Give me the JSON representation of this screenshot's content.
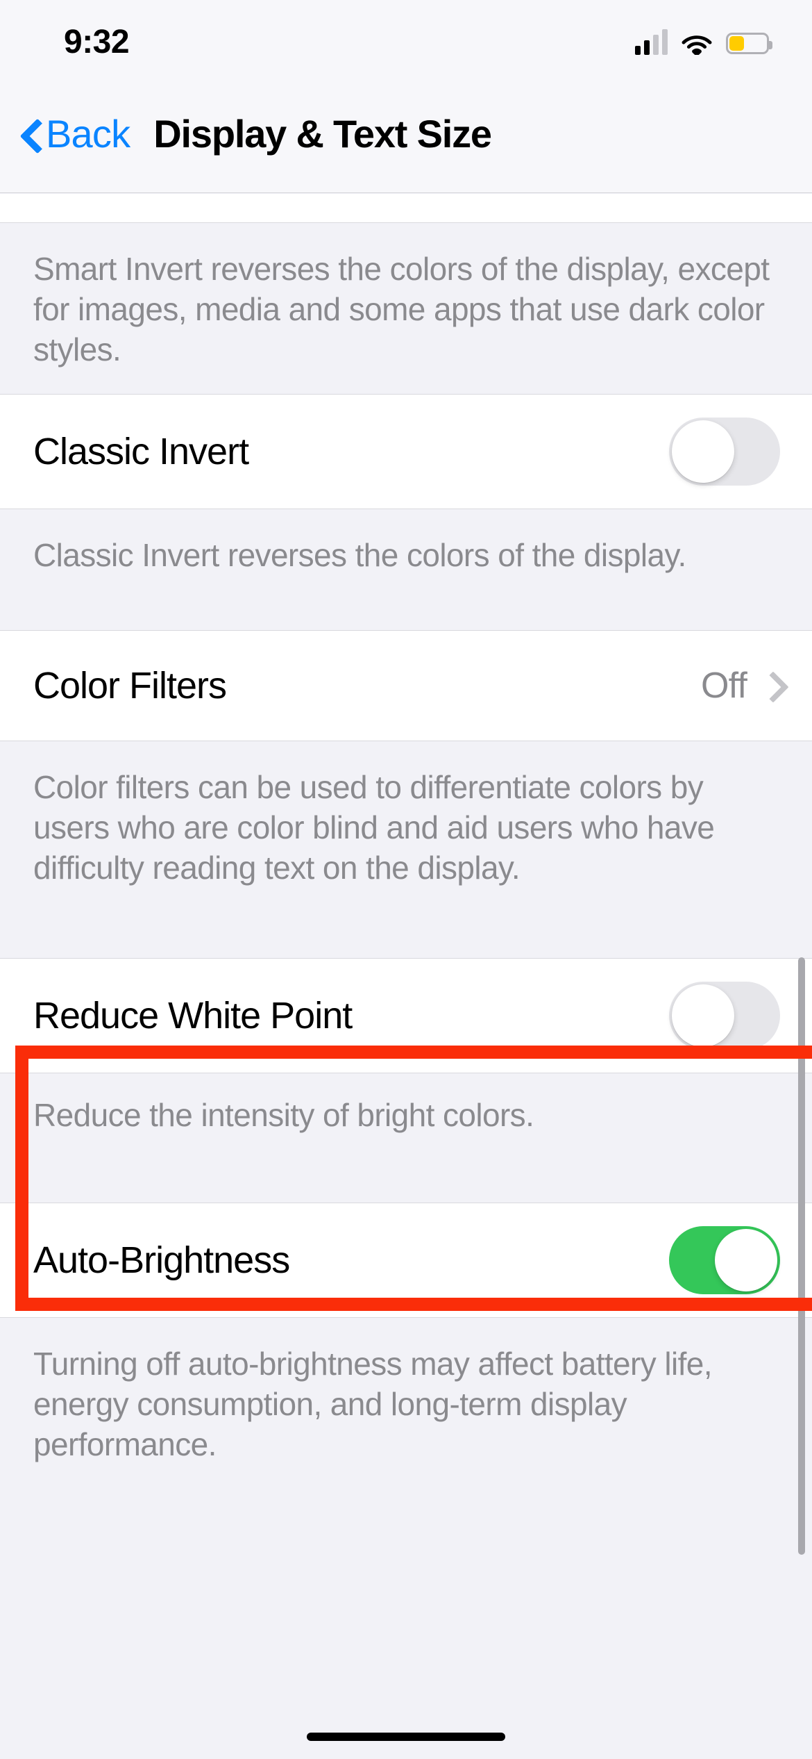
{
  "status_bar": {
    "time": "9:32",
    "cellular_icon": "cellular-signal-icon",
    "cellular_bars_filled": 2,
    "cellular_bars_total": 4,
    "wifi_icon": "wifi-icon",
    "battery_icon": "battery-icon",
    "battery_level_percent": 40,
    "battery_color": "#FFCC00"
  },
  "nav_bar": {
    "back_label": "Back",
    "back_icon": "chevron-left-icon",
    "title": "Display & Text Size",
    "accent_color": "#0A84FF"
  },
  "sections": {
    "smart_invert_footer": "Smart Invert reverses the colors of the display, except for images, media and some apps that use dark color styles.",
    "classic_invert": {
      "label": "Classic Invert",
      "toggle_state": "off"
    },
    "classic_invert_footer": "Classic Invert reverses the colors of the display.",
    "color_filters": {
      "label": "Color Filters",
      "value": "Off",
      "chevron_icon": "chevron-right-icon"
    },
    "color_filters_footer": "Color filters can be used to differentiate colors by users who are color blind and aid users who have difficulty reading text on the display.",
    "reduce_white_point": {
      "label": "Reduce White Point",
      "toggle_state": "off"
    },
    "reduce_white_point_footer": "Reduce the intensity of bright colors.",
    "auto_brightness": {
      "label": "Auto-Brightness",
      "toggle_state": "on",
      "toggle_color": "#34C759"
    },
    "auto_brightness_footer": "Turning off auto-brightness may affect battery life, energy consumption, and long-term display performance."
  },
  "annotation": {
    "highlight_color": "#FA2D09",
    "target": "reduce-white-point-row"
  }
}
